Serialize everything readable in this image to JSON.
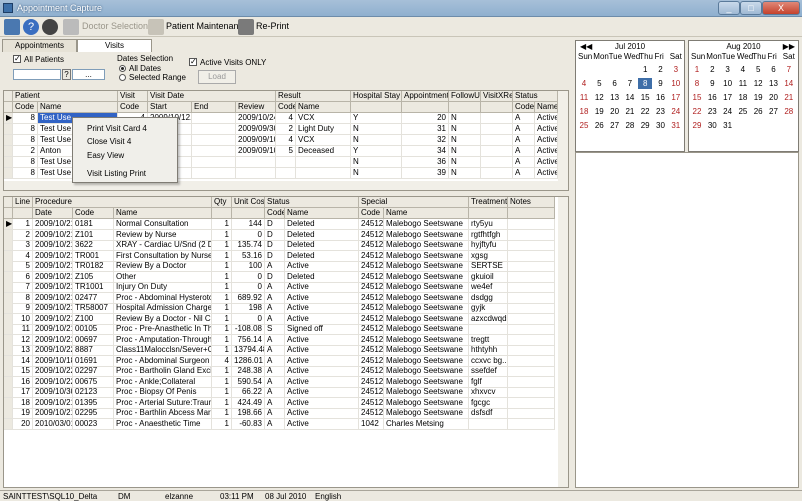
{
  "window": {
    "title": "Appointment Capture",
    "min": "_",
    "max": "□",
    "close": "X"
  },
  "toolbar": {
    "doctor_selection": "Doctor Selection",
    "patient_maintenance": "Patient Maintenance",
    "reprint": "Re-Print"
  },
  "tabs": [
    "Appointments",
    "Visits"
  ],
  "filters": {
    "all_patients": "All Patients",
    "question_btn": "?",
    "ellipsis": "...",
    "dates_selection": "Dates Selection",
    "all_dates": "All Dates",
    "selected_range": "Selected Range",
    "active_visits_only": "Active Visits ONLY",
    "load": "Load"
  },
  "visits_grid": {
    "group_headers": [
      "Patient",
      "Visit",
      "Visit Date",
      "Result",
      "Hospital Stay",
      "Appointment",
      "FollowUp",
      "VisitXRef",
      "Status"
    ],
    "sub_headers": [
      "Code",
      "Name",
      "Code",
      "Start",
      "End",
      "Review",
      "Code",
      "Name",
      "Code",
      "Name"
    ],
    "rows": [
      {
        "code": "8",
        "name": "Test Use",
        "visit": "4",
        "start": "2009/10/12...",
        "review": "2009/10/24",
        "rcode": "4",
        "rname": "VCX",
        "hosp": "Y",
        "appt": "20",
        "fu": "N",
        "scode": "A",
        "sname": "Active"
      },
      {
        "code": "8",
        "name": "Test Use",
        "visit": "",
        "start": "'26...",
        "review": "2009/09/30",
        "rcode": "2",
        "rname": "Light Duty",
        "hosp": "N",
        "appt": "31",
        "fu": "N",
        "scode": "A",
        "sname": "Active"
      },
      {
        "code": "8",
        "name": "Test Use",
        "visit": "",
        "start": "'26...",
        "review": "2009/09/10",
        "rcode": "4",
        "rname": "VCX",
        "hosp": "N",
        "appt": "32",
        "fu": "N",
        "scode": "A",
        "sname": "Active"
      },
      {
        "code": "2",
        "name": "Anton",
        "visit": "",
        "start": "'26...",
        "review": "2009/09/10",
        "rcode": "5",
        "rname": "Deceased",
        "hosp": "Y",
        "appt": "34",
        "fu": "N",
        "scode": "A",
        "sname": "Active"
      },
      {
        "code": "8",
        "name": "Test Use",
        "visit": "",
        "start": "'27...",
        "review": "",
        "rcode": "",
        "rname": "",
        "hosp": "N",
        "appt": "36",
        "fu": "N",
        "scode": "A",
        "sname": "Active"
      },
      {
        "code": "8",
        "name": "Test Use",
        "visit": "",
        "start": "'27...",
        "review": "",
        "rcode": "",
        "rname": "",
        "hosp": "N",
        "appt": "39",
        "fu": "N",
        "scode": "A",
        "sname": "Active"
      }
    ]
  },
  "context_menu": [
    "Print Visit Card 4",
    "Close Visit 4",
    "Easy View",
    "Visit Listing Print"
  ],
  "procedures_grid": {
    "group_headers": [
      "Line",
      "Procedure",
      "Qty",
      "Unit Cost",
      "Status",
      "Special",
      "Treatment",
      "Notes"
    ],
    "sub_headers": [
      "Date",
      "Code",
      "Name",
      "Code",
      "Name",
      "Code",
      "Name"
    ],
    "rows": [
      [
        "1",
        "2009/10/21",
        "0181",
        "Normal Consultation",
        "1",
        "144",
        "D",
        "Deleted",
        "24512",
        "Malebogo Seetswane",
        "rty5yu"
      ],
      [
        "2",
        "2009/10/21",
        "Z101",
        "Review by Nurse",
        "1",
        "0",
        "D",
        "Deleted",
        "24512",
        "Malebogo Seetswane",
        "rgtfhtfgh"
      ],
      [
        "3",
        "2009/10/21",
        "3622",
        "XRAY - Cardiac U/Snd (2 Dim",
        "1",
        "135.74",
        "D",
        "Deleted",
        "24512",
        "Malebogo Seetswane",
        "hyjftyfu"
      ],
      [
        "4",
        "2009/10/21",
        "TR001",
        "First Consultation by Nurse",
        "1",
        "53.16",
        "D",
        "Deleted",
        "24512",
        "Malebogo Seetswane",
        "xgsg"
      ],
      [
        "5",
        "2009/10/21",
        "TR0182",
        "Review By a Doctor",
        "1",
        "100",
        "A",
        "Active",
        "24512",
        "Malebogo Seetswane",
        "SERTSE"
      ],
      [
        "6",
        "2009/10/21",
        "Z105",
        "Other",
        "1",
        "0",
        "D",
        "Deleted",
        "24512",
        "Malebogo Seetswane",
        "gkuioil"
      ],
      [
        "7",
        "2009/10/21",
        "TR1001",
        "Injury On Duty",
        "1",
        "0",
        "A",
        "Active",
        "24512",
        "Malebogo Seetswane",
        "we4ef"
      ],
      [
        "8",
        "2009/10/21",
        "02477",
        "Proc - Abdominal Hysterotomy",
        "1",
        "689.92",
        "A",
        "Active",
        "24512",
        "Malebogo Seetswane",
        "dsdgg"
      ],
      [
        "9",
        "2009/10/21",
        "TR58007",
        "Hospital Admission Charge",
        "1",
        "198",
        "A",
        "Active",
        "24512",
        "Malebogo Seetswane",
        "gyjk"
      ],
      [
        "10",
        "2009/10/21",
        "Z100",
        "Review By a Doctor - Nil Charge",
        "1",
        "0",
        "A",
        "Active",
        "24512",
        "Malebogo Seetswane",
        "azxcdwqd"
      ],
      [
        "11",
        "2009/10/21",
        "00105",
        "Proc - Pre-Anasthetic In Theatre",
        "1",
        "-108.08",
        "S",
        "Signed off",
        "24512",
        "Malebogo Seetswane",
        ""
      ],
      [
        "12",
        "2009/10/21",
        "00697",
        "Proc - Amputation-Through Thi...",
        "1",
        "756.14",
        "A",
        "Active",
        "24512",
        "Malebogo Seetswane",
        "tregtt"
      ],
      [
        "13",
        "2009/10/22",
        "8887",
        "Class11Malocclsn/Sever+Comp",
        "1",
        "13794.48",
        "A",
        "Active",
        "24512",
        "Malebogo Seetswane",
        "hthtyhh"
      ],
      [
        "14",
        "2009/10/18",
        "01691",
        "Proc - Abdominal Surgeon",
        "4",
        "1286.01",
        "A",
        "Active",
        "24512",
        "Malebogo Seetswane",
        "ccxvc bg..."
      ],
      [
        "15",
        "2009/10/22",
        "02297",
        "Proc - Bartholin Gland Excision",
        "1",
        "248.38",
        "A",
        "Active",
        "24512",
        "Malebogo Seetswane",
        "ssefdef"
      ],
      [
        "16",
        "2009/10/22",
        "00675",
        "Proc - Ankle;Collateral",
        "1",
        "590.54",
        "A",
        "Active",
        "24512",
        "Malebogo Seetswane",
        "fglf"
      ],
      [
        "17",
        "2009/10/30",
        "02123",
        "Proc - Biopsy Of Penis",
        "1",
        "66.22",
        "A",
        "Active",
        "24512",
        "Malebogo Seetswane",
        "xhxvcv"
      ],
      [
        "18",
        "2009/10/21",
        "01395",
        "Proc - Arterial Suture:Trauma",
        "1",
        "424.49",
        "A",
        "Active",
        "24512",
        "Malebogo Seetswane",
        "fgcgc"
      ],
      [
        "19",
        "2009/10/21",
        "02295",
        "Proc - Barthlin Abcess Marsu...",
        "1",
        "198.66",
        "A",
        "Active",
        "24512",
        "Malebogo Seetswane",
        "dsfsdf"
      ],
      [
        "20",
        "2010/03/01",
        "00023",
        "Proc - Anaesthetic Time",
        "1",
        "-60.83",
        "A",
        "Active",
        "1042",
        "Charles Metsing",
        ""
      ]
    ]
  },
  "calendars": [
    {
      "title": "Jul 2010",
      "days": [
        "Sun",
        "Mon",
        "Tue",
        "Wed",
        "Thu",
        "Fri",
        "Sat"
      ],
      "start": 4,
      "count": 31,
      "selected": 8
    },
    {
      "title": "Aug 2010",
      "days": [
        "Sun",
        "Mon",
        "Tue",
        "Wed",
        "Thu",
        "Fri",
        "Sat"
      ],
      "start": 0,
      "count": 31,
      "selected": 0
    }
  ],
  "status_bar": [
    "SAINTTEST\\SQL10_Delta",
    "DM",
    "elzanne",
    "03:11 PM",
    "08 Jul 2010",
    "English"
  ],
  "colors": {
    "selected_day": "#3e6ea8",
    "weekend": "#b02020",
    "title": "#8fb0cf"
  }
}
